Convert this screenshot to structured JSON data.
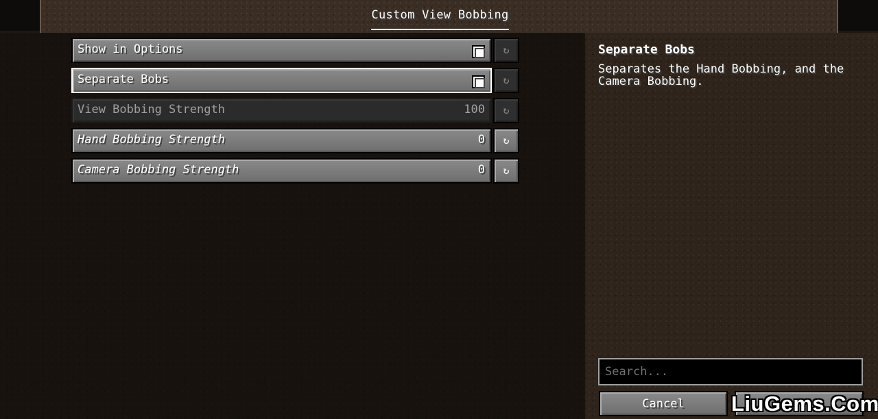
{
  "header": {
    "tab_title": "Custom View Bobbing"
  },
  "options": [
    {
      "label": "Show in Options",
      "type": "checkbox",
      "checked": true,
      "value": "",
      "selected": false,
      "disabled": false,
      "italic": false
    },
    {
      "label": "Separate Bobs",
      "type": "checkbox",
      "checked": true,
      "value": "",
      "selected": true,
      "disabled": false,
      "italic": false
    },
    {
      "label": "View Bobbing Strength",
      "type": "slider",
      "value": "100",
      "selected": false,
      "disabled": true,
      "italic": false
    },
    {
      "label": "Hand Bobbing Strength",
      "type": "slider",
      "value": "0",
      "selected": false,
      "disabled": false,
      "italic": true
    },
    {
      "label": "Camera Bobbing Strength",
      "type": "slider",
      "value": "0",
      "selected": false,
      "disabled": false,
      "italic": true
    }
  ],
  "reset_icon": "↻",
  "description": {
    "title": "Separate Bobs",
    "text": "Separates the Hand Bobbing, and the Camera Bobbing."
  },
  "search": {
    "placeholder": "Search...",
    "value": ""
  },
  "footer": {
    "cancel_label": "Cancel",
    "done_label": ""
  },
  "watermark": "LiuGems.Com",
  "icons": {
    "reset": "reset-icon",
    "checkbox": "checkbox-icon"
  }
}
